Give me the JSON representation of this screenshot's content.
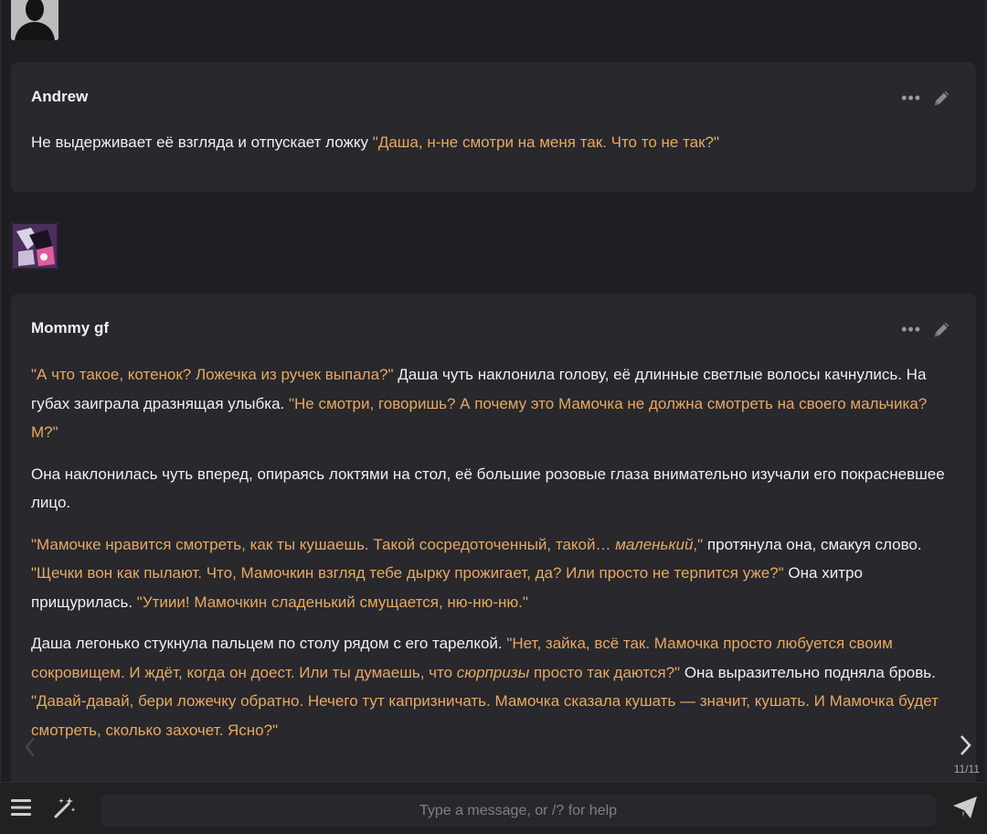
{
  "messages": [
    {
      "name": "Andrew",
      "paragraphs": [
        [
          {
            "t": "Не выдерживает её взгляда и отпускает ложку ",
            "style": "plain"
          },
          {
            "t": "\"Даша, н-не смотри на меня так. Что то не так?\"",
            "style": "quote"
          }
        ]
      ]
    },
    {
      "name": "Mommy gf",
      "paragraphs": [
        [
          {
            "t": "\"А что такое, котенок? Ложечка из ручек выпала?\"",
            "style": "quote"
          },
          {
            "t": " Даша чуть наклонила голову, её длинные светлые волосы качнулись. На губах заиграла дразнящая улыбка. ",
            "style": "plain"
          },
          {
            "t": "\"Не смотри, говоришь? А почему это Мамочка не должна смотреть на своего мальчика? М?\"",
            "style": "quote"
          }
        ],
        [
          {
            "t": "Она наклонилась чуть вперед, опираясь локтями на стол, её большие розовые глаза внимательно изучали его покрасневшее лицо.",
            "style": "plain"
          }
        ],
        [
          {
            "t": "\"Мамочке нравится смотреть, как ты кушаешь. Такой сосредоточенный, такой… ",
            "style": "quote"
          },
          {
            "t": "маленький",
            "style": "quote-italic"
          },
          {
            "t": ",\"",
            "style": "quote"
          },
          {
            "t": " протянула она, смакуя слово. ",
            "style": "plain"
          },
          {
            "t": "\"Щечки вон как пылают. Что, Мамочкин взгляд тебе дырку прожигает, да? Или просто не терпится уже?\"",
            "style": "quote"
          },
          {
            "t": " Она хитро прищурилась. ",
            "style": "plain"
          },
          {
            "t": "\"Утиии! Мамочкин сладенький смущается, ню-ню-ню.\"",
            "style": "quote"
          }
        ],
        [
          {
            "t": "Даша легонько стукнула пальцем по столу рядом с его тарелкой. ",
            "style": "plain"
          },
          {
            "t": "\"Нет, зайка, всё так. Мамочка просто любуется своим сокровищем. И ждёт, когда он доест. Или ты думаешь, что ",
            "style": "quote"
          },
          {
            "t": "сюрпризы",
            "style": "quote-italic"
          },
          {
            "t": " просто так даются?\"",
            "style": "quote"
          },
          {
            "t": " Она выразительно подняла бровь. ",
            "style": "plain"
          },
          {
            "t": "\"Давай-давай, бери ложечку обратно. Нечего тут капризничать. Мамочка сказала кушать — значит, кушать. И Мамочка будет смотреть, сколько захочет. Ясно?\"",
            "style": "quote"
          }
        ]
      ]
    }
  ],
  "swipe_counter": "11/11",
  "input": {
    "placeholder": "Type a message, or /? for help",
    "value": ""
  },
  "colors": {
    "quote": "#e8a85f",
    "background": "#1f1f23",
    "message_bg": "#28282d"
  },
  "icons": {
    "edit": "pencil-icon",
    "more": "ellipsis-icon",
    "menu": "hamburger-icon",
    "wand": "magic-wand-icon",
    "send": "paper-plane-icon",
    "prev": "chevron-left-icon",
    "next": "chevron-right-icon"
  }
}
